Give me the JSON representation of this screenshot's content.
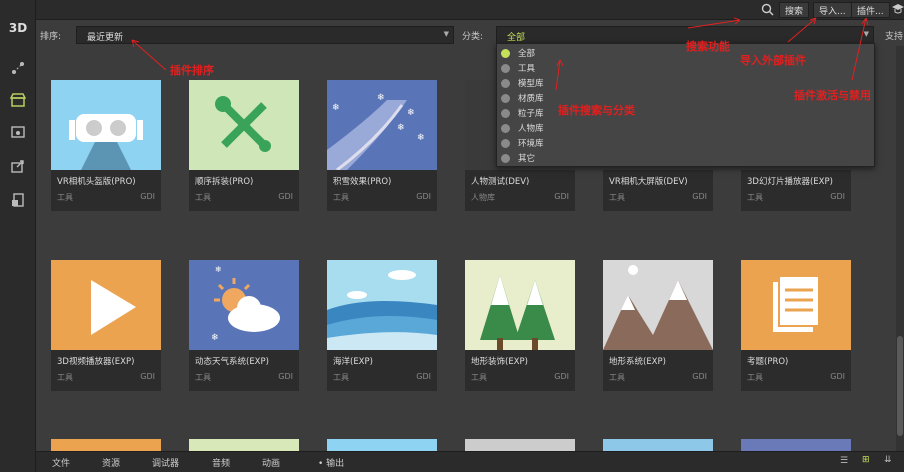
{
  "sidebar": {
    "logo": "3D"
  },
  "topbar": {
    "search": "搜索",
    "import": "导入...",
    "plugins": "插件..."
  },
  "filter": {
    "sort_label": "排序:",
    "sort_value": "最近更新",
    "category_label": "分类:",
    "category_value": "全部",
    "support": "支持"
  },
  "dropdown": {
    "items": [
      "全部",
      "工具",
      "模型库",
      "材质库",
      "粒子库",
      "人物库",
      "环境库",
      "其它"
    ]
  },
  "cards": [
    {
      "name": "VR相机头盔版(PRO)",
      "category": "工具",
      "tag": "GDI"
    },
    {
      "name": "顺序拆装(PRO)",
      "category": "工具",
      "tag": "GDI"
    },
    {
      "name": "积雪效果(PRO)",
      "category": "工具",
      "tag": "GDI"
    },
    {
      "name": "人物测试(DEV)",
      "category": "人物库",
      "tag": "GDI"
    },
    {
      "name": "VR相机大屏版(DEV)",
      "category": "工具",
      "tag": "GDI"
    },
    {
      "name": "3D幻灯片播放器(EXP)",
      "category": "工具",
      "tag": "GDI"
    },
    {
      "name": "3D视频播放器(EXP)",
      "category": "工具",
      "tag": "GDI"
    },
    {
      "name": "动态天气系统(EXP)",
      "category": "工具",
      "tag": "GDI"
    },
    {
      "name": "海洋(EXP)",
      "category": "工具",
      "tag": "GDI"
    },
    {
      "name": "地形装饰(EXP)",
      "category": "工具",
      "tag": "GDI"
    },
    {
      "name": "地形系统(EXP)",
      "category": "工具",
      "tag": "GDI"
    },
    {
      "name": "考题(PRO)",
      "category": "工具",
      "tag": "GDI"
    }
  ],
  "bottom_tabs": [
    "文件",
    "资源",
    "调试器",
    "音频",
    "动画",
    "输出"
  ],
  "annotations": {
    "sort": "插件排序",
    "search": "搜索功能",
    "import": "导入外部插件",
    "category": "插件搜索与分类",
    "enable": "插件激活与禁用"
  },
  "colors": {
    "accent": "#c5e05a",
    "annotation": "#e02020"
  }
}
